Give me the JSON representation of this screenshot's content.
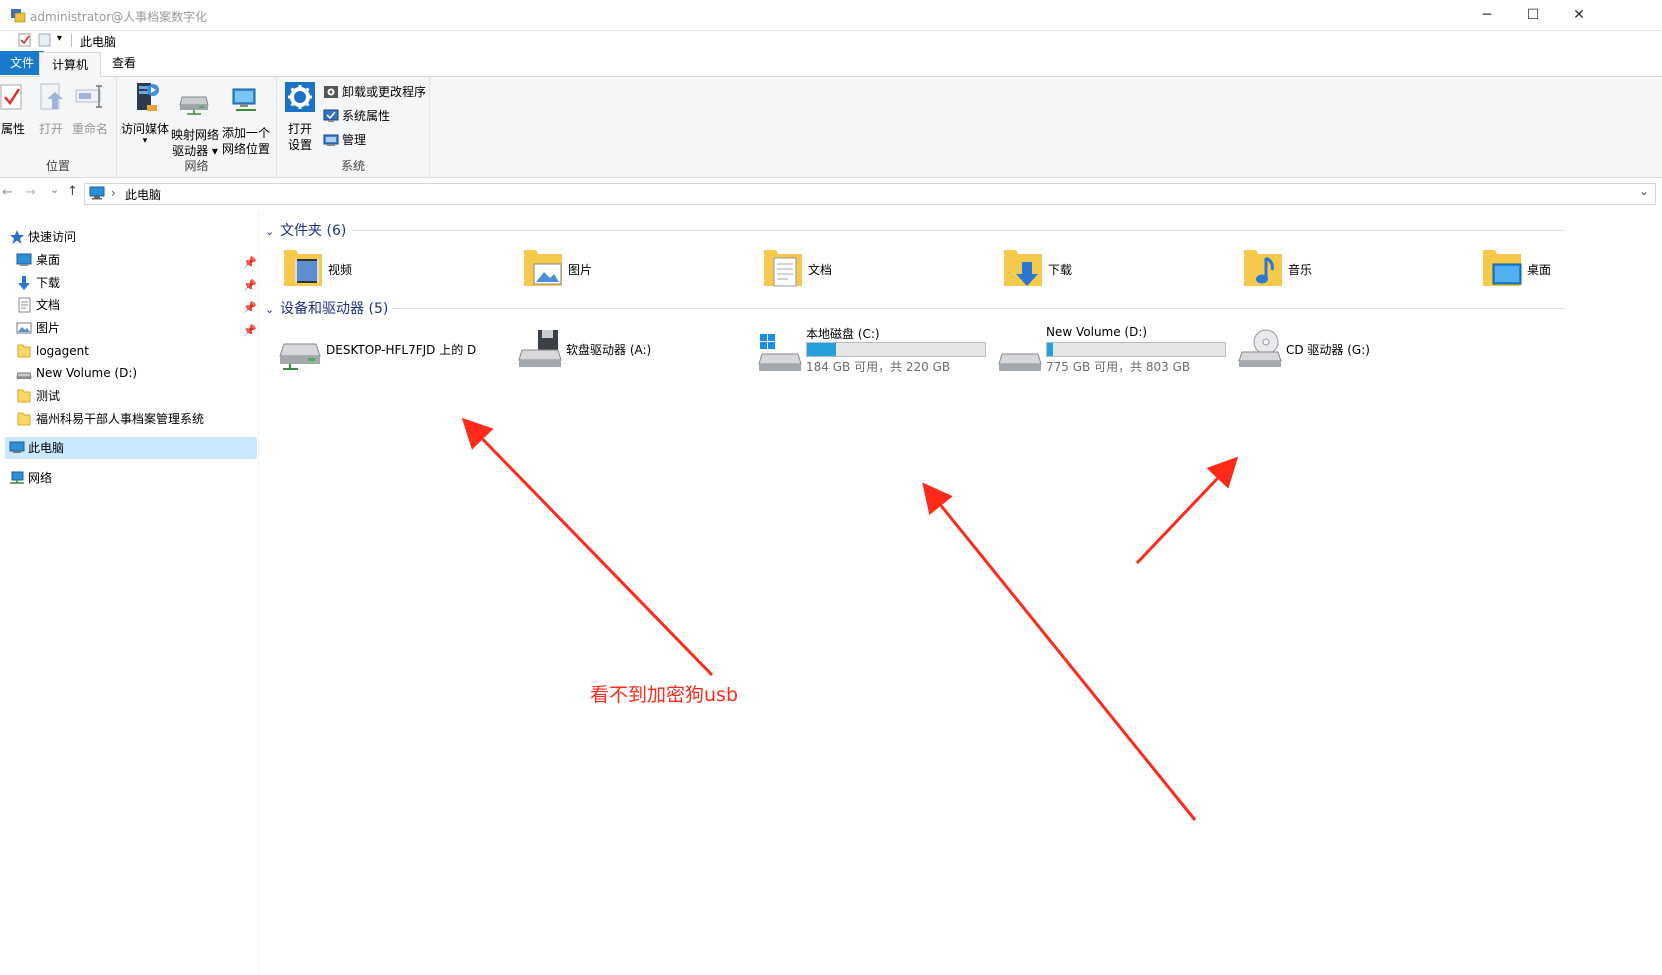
{
  "window": {
    "title": "administrator@人事档案数字化",
    "minimize": "─",
    "maximize": "☐",
    "close": "✕"
  },
  "qat": {
    "location": "此电脑"
  },
  "tabs": [
    {
      "label": "文件"
    },
    {
      "label": "计算机"
    },
    {
      "label": "查看"
    }
  ],
  "ribbon": {
    "location": {
      "label": "位置",
      "buttons": [
        "属性",
        "打开",
        "重命名"
      ]
    },
    "network": {
      "label": "网络",
      "buttons": [
        {
          "l1": "访问媒体",
          "l2": "▾"
        },
        {
          "l1": "映射网络",
          "l2": "驱动器 ▾"
        },
        {
          "l1": "添加一个",
          "l2": "网络位置"
        }
      ]
    },
    "system": {
      "label": "系统",
      "open_l1": "打开",
      "open_l2": "设置",
      "small": [
        "卸载或更改程序",
        "系统属性",
        "管理"
      ]
    }
  },
  "address": {
    "back": "←",
    "forward": "→",
    "recent": "⌄",
    "up": "↑",
    "crumb_sep": "›",
    "crumb": "此电脑",
    "dropdown": "⌄"
  },
  "nav": {
    "quick_access": "快速访问",
    "items": [
      {
        "label": "桌面",
        "pinned": true
      },
      {
        "label": "下载",
        "pinned": true
      },
      {
        "label": "文档",
        "pinned": true
      },
      {
        "label": "图片",
        "pinned": true
      },
      {
        "label": "logagent",
        "pinned": false
      },
      {
        "label": "New Volume (D:)",
        "pinned": false
      },
      {
        "label": "测试",
        "pinned": false
      },
      {
        "label": "福州科易干部人事档案管理系统",
        "pinned": false
      }
    ],
    "this_pc": "此电脑",
    "network": "网络"
  },
  "folders": {
    "header": "文件夹 (6)",
    "items": [
      "视频",
      "图片",
      "文档",
      "下载",
      "音乐",
      "桌面"
    ]
  },
  "devices": {
    "header": "设备和驱动器 (5)",
    "items": [
      {
        "name": "DESKTOP-HFL7FJD 上的 D"
      },
      {
        "name": "软盘驱动器 (A:)"
      },
      {
        "name": "本地磁盘 (C:)",
        "usage": 0.164,
        "info": "184 GB 可用，共 220 GB"
      },
      {
        "name": "New Volume (D:)",
        "usage": 0.035,
        "info": "775 GB 可用，共 803 GB"
      },
      {
        "name": "CD 驱动器 (G:)"
      }
    ]
  },
  "annotation": "看不到加密狗usb",
  "colors": {
    "accent": "#1979ca",
    "bar": "#26a0da",
    "arrow": "#ff2a1a",
    "selected": "#cce8ff"
  }
}
